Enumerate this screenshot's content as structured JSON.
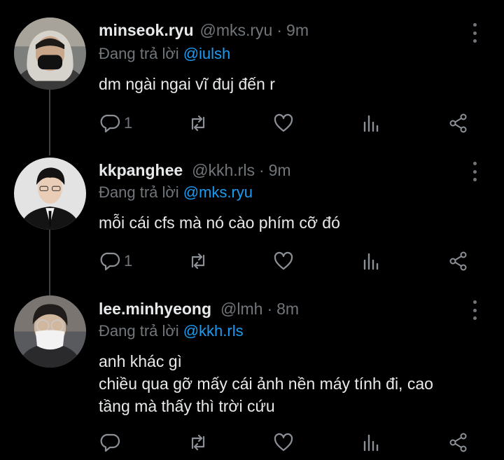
{
  "tweets": [
    {
      "name": "minseok.ryu",
      "handle": "@mks.ryu",
      "dot": "·",
      "time": "9m",
      "reply_prefix": "Đang trả lời",
      "reply_mention": "@iulsh",
      "lines": [
        "dm ngài ngai vĩ đuj đến r"
      ],
      "reply_count": "1",
      "avatar_bg": "#8a8a86"
    },
    {
      "name": "kkpanghee",
      "handle": "@kkh.rls",
      "dot": "·",
      "time": "9m",
      "reply_prefix": "Đang trả lời",
      "reply_mention": "@mks.ryu",
      "lines": [
        "mỗi cái cfs mà nó cào phím cỡ đó"
      ],
      "reply_count": "1",
      "avatar_bg": "#dcdcdc"
    },
    {
      "name": "lee.minhyeong",
      "handle": "@lmh",
      "dot": "·",
      "time": "8m",
      "reply_prefix": "Đang trả lời",
      "reply_mention": "@kkh.rls",
      "lines": [
        "anh khác gì",
        "chiều qua gỡ mấy cái ảnh nền máy tính đi, cao",
        "tầng mà thấy thì trời cứu"
      ],
      "reply_count": "",
      "avatar_bg": "#6b6e72"
    }
  ],
  "colors": {
    "background": "#000000",
    "text": "#e7e9ea",
    "secondary": "#71767b",
    "mention": "#1d9bf0",
    "thread_line": "#3d4247"
  },
  "icons": [
    "reply-icon",
    "retweet-icon",
    "like-icon",
    "views-icon",
    "share-icon",
    "more-icon"
  ]
}
